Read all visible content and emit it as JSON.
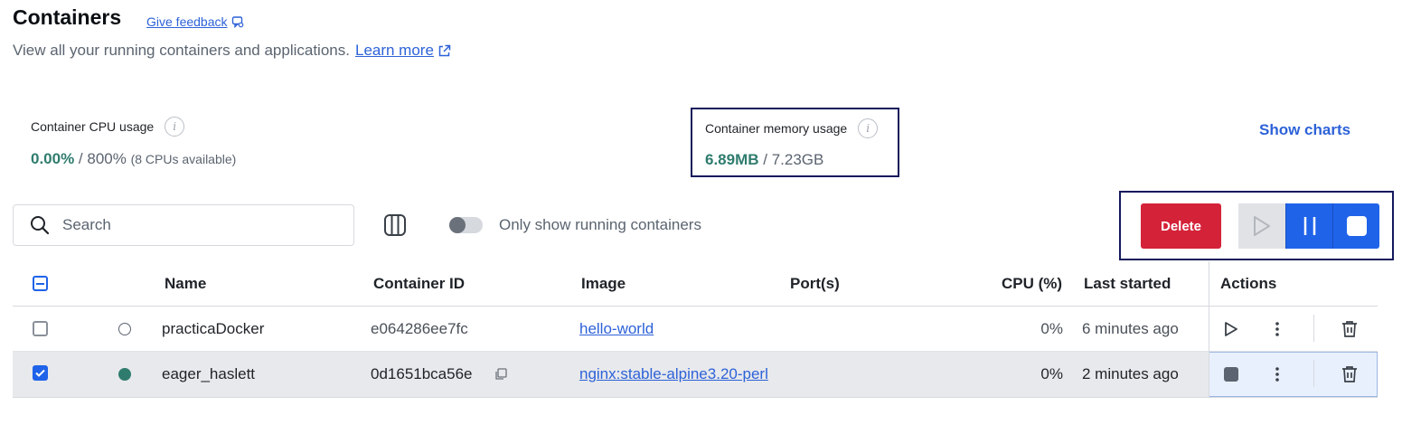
{
  "header": {
    "title": "Containers",
    "feedback_label": "Give feedback",
    "subtitle": "View all your running containers and applications.",
    "learn_more": "Learn more"
  },
  "stats": {
    "cpu": {
      "label": "Container CPU usage",
      "used": "0.00%",
      "separator": " / ",
      "total": "800%",
      "note": "(8 CPUs available)"
    },
    "memory": {
      "label": "Container memory usage",
      "used": "6.89MB",
      "separator": " / ",
      "total": "7.23GB"
    },
    "show_charts": "Show charts"
  },
  "toolbar": {
    "search_placeholder": "Search",
    "toggle_label": "Only show running containers",
    "delete_label": "Delete"
  },
  "table": {
    "columns": [
      "Name",
      "Container ID",
      "Image",
      "Port(s)",
      "CPU (%)",
      "Last started",
      "Actions"
    ],
    "rows": [
      {
        "name": "practicaDocker",
        "container_id": "e064286ee7fc",
        "image": "hello-world",
        "ports": "",
        "cpu": "0%",
        "last_started": "6 minutes ago",
        "selected": false,
        "running": false
      },
      {
        "name": "eager_haslett",
        "container_id": "0d1651bca56e",
        "image": "nginx:stable-alpine3.20-perl",
        "ports": "",
        "cpu": "0%",
        "last_started": "2 minutes ago",
        "selected": true,
        "running": true
      }
    ]
  },
  "colors": {
    "accent": "#1f63e9",
    "link": "#2d62d8",
    "danger": "#d42239",
    "running": "#2f7c6e",
    "highlight_border": "#141a5c"
  }
}
